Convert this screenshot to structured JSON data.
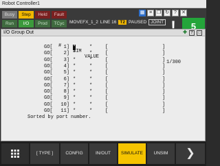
{
  "window": {
    "title": "Robot Controller1"
  },
  "status": {
    "busy": "Busy",
    "step": "Step",
    "hold": "Held",
    "fault": "Fault",
    "run": "Run",
    "io": "I/O",
    "prod": "Prod",
    "tcyc": "TCyc"
  },
  "program_line": {
    "name": "MOVEFX_1_2",
    "line": "LINE 16",
    "mode": "T2",
    "state": "PAUSED",
    "coord": "JOINT"
  },
  "info_icon": "!",
  "badge_count": "5",
  "screen": {
    "title": "I/O Group Out",
    "range": "1/300",
    "headers": {
      "num": "#",
      "sim": "SIM",
      "value": "VALUE"
    },
    "rows": [
      {
        "label": "GO[",
        "idx": "1]",
        "sim": "*",
        "value": "*",
        "lb": "[",
        "rb": "]"
      },
      {
        "label": "GO[",
        "idx": "2]",
        "sim": "*",
        "value": "*",
        "lb": "[",
        "rb": "]"
      },
      {
        "label": "GO[",
        "idx": "3]",
        "sim": "*",
        "value": "*",
        "lb": "[",
        "rb": "]"
      },
      {
        "label": "GO[",
        "idx": "4]",
        "sim": "*",
        "value": "*",
        "lb": "[",
        "rb": "]"
      },
      {
        "label": "GO[",
        "idx": "5]",
        "sim": "*",
        "value": "*",
        "lb": "[",
        "rb": "]"
      },
      {
        "label": "GO[",
        "idx": "6]",
        "sim": "*",
        "value": "*",
        "lb": "[",
        "rb": "]"
      },
      {
        "label": "GO[",
        "idx": "7]",
        "sim": "*",
        "value": "*",
        "lb": "[",
        "rb": "]"
      },
      {
        "label": "GO[",
        "idx": "8]",
        "sim": "*",
        "value": "*",
        "lb": "[",
        "rb": "]"
      },
      {
        "label": "GO[",
        "idx": "9]",
        "sim": "*",
        "value": "*",
        "lb": "[",
        "rb": "]"
      },
      {
        "label": "GO[",
        "idx": "10]",
        "sim": "*",
        "value": "*",
        "lb": "[",
        "rb": "]"
      },
      {
        "label": "GO[",
        "idx": "11]",
        "sim": "*",
        "value": "*",
        "lb": "[",
        "rb": "]"
      }
    ],
    "footer": "Sorted by port number."
  },
  "softkeys": [
    "[ TYPE ]",
    "CONFIG",
    "IN/OUT",
    "SIMULATE",
    "UNSIM"
  ],
  "icons": {
    "window": [
      "grid-icon",
      "list-icon",
      "restore-icon",
      "refresh-icon",
      "help-icon",
      "close-icon"
    ],
    "screen": [
      "plus-icon",
      "help-icon",
      "maximize-icon"
    ]
  },
  "colors": {
    "step": "#f2b800",
    "io": "#3c9a3c",
    "badge": "#24a53a",
    "simulate": "#f5c400",
    "hold": "#7a2020"
  }
}
